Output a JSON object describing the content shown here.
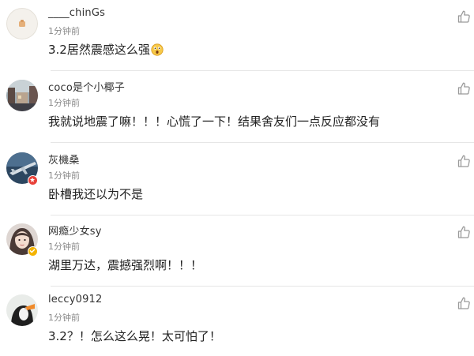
{
  "comments": [
    {
      "username": "____chinGs",
      "time": "1分钟前",
      "text": "3.2居然震感这么强",
      "emoji": "surprised-face",
      "avatar": "beige-placeholder"
    },
    {
      "username": "coco是个小椰子",
      "time": "1分钟前",
      "text": "我就说地震了嘛！！！心慌了一下！结果舍友们一点反应都没有",
      "avatar": "street-photo"
    },
    {
      "username": "灰機桑",
      "time": "1分钟前",
      "text": "卧槽我还以为不是",
      "avatar": "airplane-photo",
      "badge": "red-verified"
    },
    {
      "username": "网瘾少女sy",
      "time": "1分钟前",
      "text": "湖里万达，震撼强烈啊！！！",
      "avatar": "girl-photo",
      "badge": "gold-verified"
    },
    {
      "username": "leccy0912",
      "time": "1分钟前",
      "text": "3.2？！怎么这么晃！太可怕了！",
      "avatar": "bird-photo"
    }
  ],
  "colors": {
    "username": "#333333",
    "timestamp": "#8a8a8a",
    "content": "#222222",
    "like_icon": "#9a9a9a",
    "divider": "#e6e6e6"
  },
  "icons": {
    "like": "thumbs-up-outline-icon"
  }
}
